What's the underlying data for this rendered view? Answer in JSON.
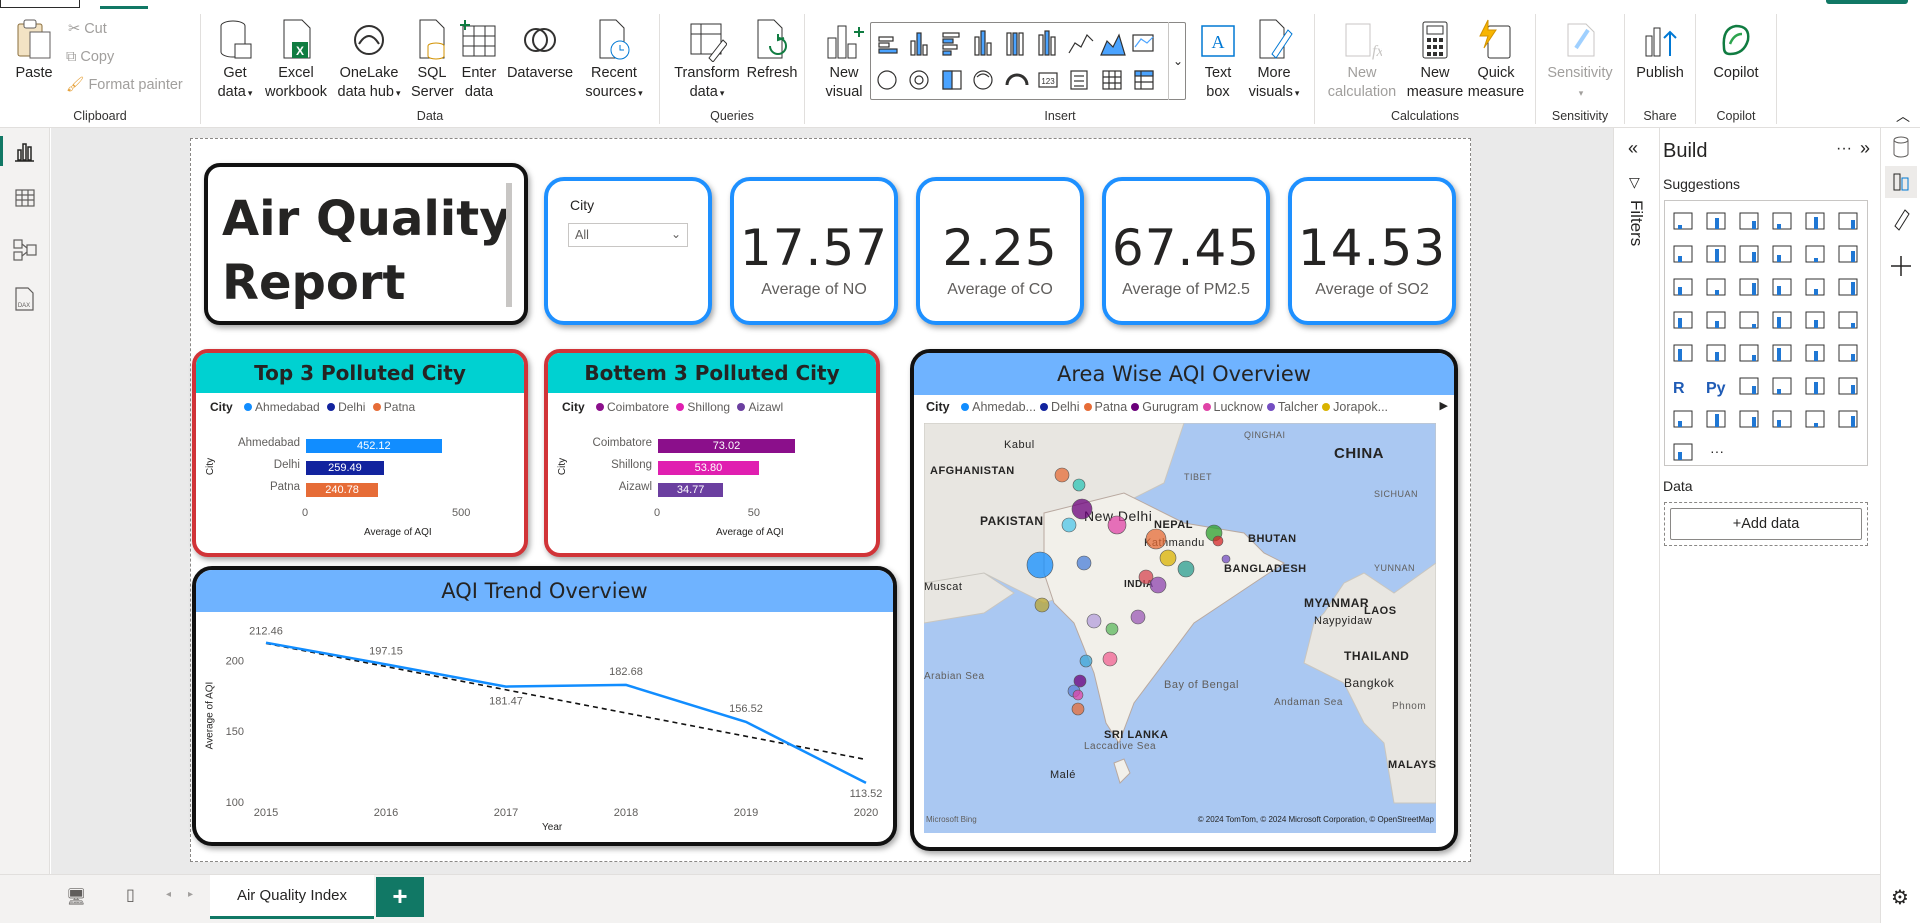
{
  "ribbon": {
    "clipboard": {
      "label": "Clipboard",
      "paste": "Paste",
      "cut": "Cut",
      "copy": "Copy",
      "format_painter": "Format painter"
    },
    "data": {
      "label": "Data",
      "get_data": [
        "Get",
        "data"
      ],
      "excel": [
        "Excel",
        "workbook"
      ],
      "onelake": [
        "OneLake",
        "data hub"
      ],
      "sql": [
        "SQL",
        "Server"
      ],
      "enter": [
        "Enter",
        "data"
      ],
      "dataverse": "Dataverse",
      "recent": [
        "Recent",
        "sources"
      ]
    },
    "queries": {
      "label": "Queries",
      "transform": [
        "Transform",
        "data"
      ],
      "refresh": "Refresh"
    },
    "insert": {
      "label": "Insert",
      "new_visual": [
        "New",
        "visual"
      ],
      "text_box": [
        "Text",
        "box"
      ],
      "more_visuals": [
        "More",
        "visuals"
      ]
    },
    "calculations": {
      "label": "Calculations",
      "new_calc": [
        "New",
        "calculation"
      ],
      "new_measure": [
        "New",
        "measure"
      ],
      "quick_measure": [
        "Quick",
        "measure"
      ]
    },
    "sensitivity": {
      "label": "Sensitivity",
      "btn": "Sensitivity"
    },
    "share": {
      "label": "Share",
      "publish": "Publish"
    },
    "copilot": {
      "label": "Copilot",
      "btn": "Copilot"
    }
  },
  "report": {
    "title_line1": "Air Quality",
    "title_line2": "Report",
    "slicer": {
      "label": "City",
      "value": "All"
    },
    "kpis": [
      {
        "value": "17.57",
        "label": "Average of NO"
      },
      {
        "value": "2.25",
        "label": "Average of CO"
      },
      {
        "value": "67.45",
        "label": "Average of PM2.5"
      },
      {
        "value": "14.53",
        "label": "Average of SO2"
      }
    ]
  },
  "chart_data": [
    {
      "type": "bar",
      "title": "Top 3 Polluted City",
      "legend_title": "City",
      "categories": [
        "Ahmedabad",
        "Delhi",
        "Patna"
      ],
      "values": [
        452.12,
        259.49,
        240.78
      ],
      "value_labels": [
        "452.12",
        "259.49",
        "240.78"
      ],
      "colors": [
        "#118dff",
        "#12239e",
        "#e66c37"
      ],
      "xlabel": "Average of AQI",
      "ylabel": "City",
      "xticks": [
        "0",
        "500"
      ],
      "xlim": [
        0,
        500
      ]
    },
    {
      "type": "bar",
      "title": "Bottem 3 Polluted City",
      "legend_title": "City",
      "categories": [
        "Coimbatore",
        "Shillong",
        "Aizawl"
      ],
      "values": [
        73.02,
        53.8,
        34.77
      ],
      "value_labels": [
        "73.02",
        "53.80",
        "34.77"
      ],
      "colors": [
        "#8b0f8b",
        "#e01fb0",
        "#6b3fa0"
      ],
      "xlabel": "Average of AQI",
      "ylabel": "City",
      "xticks": [
        "0",
        "50"
      ],
      "xlim": [
        0,
        80
      ]
    },
    {
      "type": "line",
      "title": "AQI Trend Overview",
      "x": [
        "2015",
        "2016",
        "2017",
        "2018",
        "2019",
        "2020"
      ],
      "series": [
        {
          "values": [
            212.46,
            197.15,
            181.47,
            182.68,
            156.52,
            113.52
          ],
          "color": "#118dff"
        }
      ],
      "trendline": {
        "start": 212,
        "end": 130
      },
      "value_labels": [
        "212.46",
        "197.15",
        "181.47",
        "182.68",
        "156.52",
        "113.52"
      ],
      "xlabel": "Year",
      "ylabel": "Average of AQI",
      "yticks": [
        "100",
        "150",
        "200"
      ],
      "ylim": [
        100,
        220
      ]
    }
  ],
  "map": {
    "title": "Area Wise AQI Overview",
    "legend_title": "City",
    "legend_items": [
      {
        "name": "Ahmedab...",
        "color": "#118dff"
      },
      {
        "name": "Delhi",
        "color": "#12239e"
      },
      {
        "name": "Patna",
        "color": "#e66c37"
      },
      {
        "name": "Gurugram",
        "color": "#6b007b"
      },
      {
        "name": "Lucknow",
        "color": "#e044a7"
      },
      {
        "name": "Talcher",
        "color": "#744ec2"
      },
      {
        "name": "Jorapok...",
        "color": "#d9b300"
      }
    ],
    "labels": [
      "Kabul",
      "QINGHAI",
      "CHINA",
      "AFGHANISTAN",
      "TIBET",
      "PAKISTAN",
      "New Delhi",
      "NEPAL",
      "Kathmandu",
      "BHUTAN",
      "SICHUAN",
      "BANGLADESH",
      "YUNNAN",
      "Muscat",
      "INDIA",
      "MYANMAR",
      "Naypyidaw",
      "LAOS",
      "THAILAND",
      "Arabian Sea",
      "Bay of Bengal",
      "Bangkok",
      "Andaman Sea",
      "Phnom",
      "SRI LANKA",
      "Laccadive Sea",
      "Malé",
      "MALAYSI"
    ],
    "attribution": "© 2024 TomTom, © 2024 Microsoft Corporation, © OpenStreetMap",
    "bing": "Microsoft Bing"
  },
  "filters": {
    "label": "Filters"
  },
  "build": {
    "title": "Build",
    "suggestions": "Suggestions",
    "data": "Data",
    "add_data": "+Add data"
  },
  "bottom": {
    "page_tab": "Air Quality Index",
    "add": "+"
  }
}
